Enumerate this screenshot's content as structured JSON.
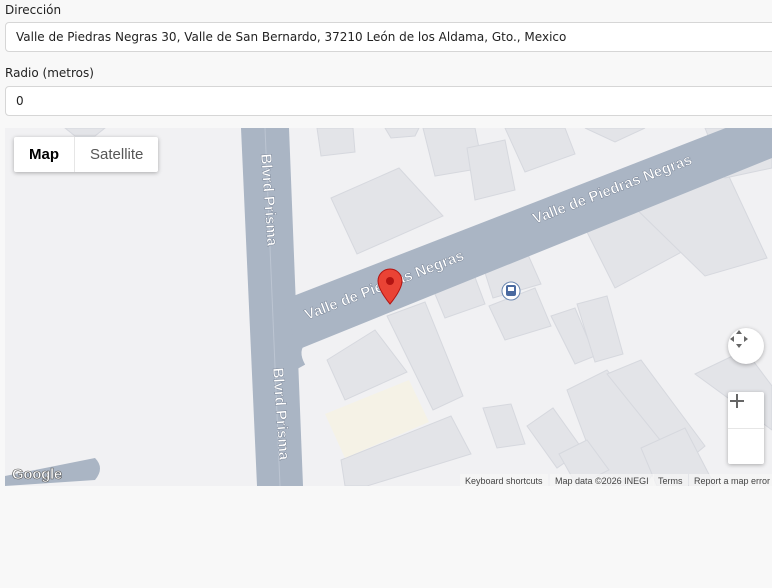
{
  "form": {
    "address_label": "Dirección",
    "address_value": "Valle de Piedras Negras 30, Valle de San Bernardo, 37210 León de los Aldama, Gto., Mexico",
    "radius_label": "Radio (metros)",
    "radius_value": "0"
  },
  "map": {
    "type_map": "Map",
    "type_satellite": "Satellite",
    "street_main_1": "Valle de Piedras Negras",
    "street_main_2": "Valle de Piedras Negras",
    "street_side_1": "Blvrd Prisma",
    "street_side_2": "Blvrd Prisma",
    "logo": "Google",
    "keyboard_shortcuts": "Keyboard shortcuts",
    "map_data": "Map data ©2026 INEGI",
    "terms": "Terms",
    "report_error": "Report a map error",
    "marker_color": "#ea4335",
    "road_color": "#aab5c4"
  }
}
